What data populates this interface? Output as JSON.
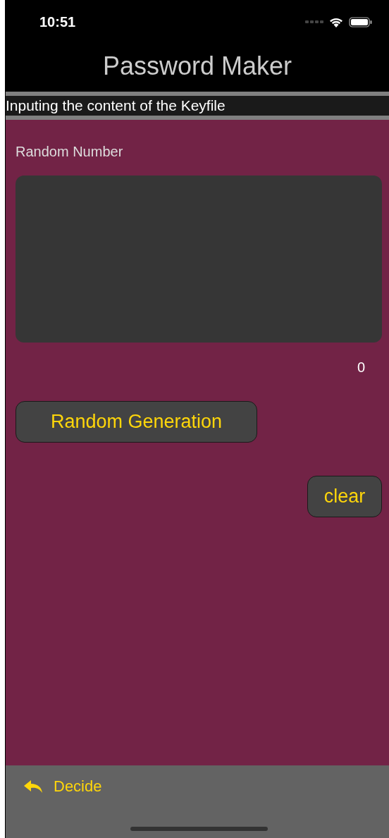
{
  "status_bar": {
    "time": "10:51"
  },
  "nav": {
    "title": "Password Maker"
  },
  "subtitle": "Inputing the content of the Keyfile",
  "random_number": {
    "label": "Random Number",
    "count": "0"
  },
  "buttons": {
    "generate": "Random Generation",
    "clear": "clear"
  },
  "toolbar": {
    "decide": "Decide"
  }
}
